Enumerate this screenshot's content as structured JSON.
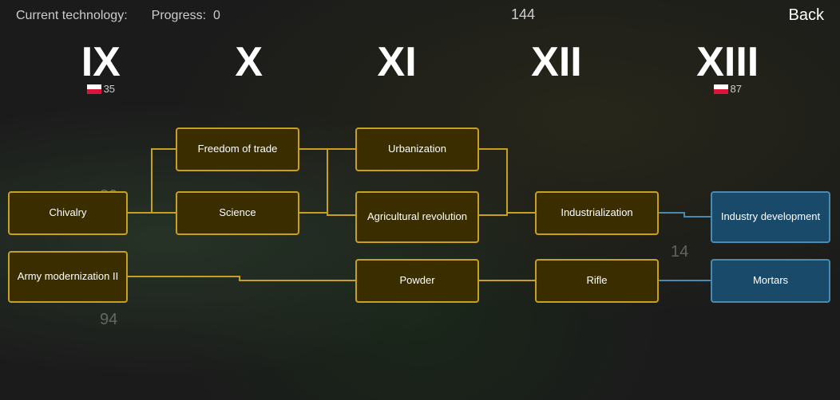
{
  "header": {
    "current_tech_label": "Current technology:",
    "progress_label": "Progress:",
    "progress_value": "0",
    "back_label": "Back"
  },
  "numerals": [
    {
      "id": "IX",
      "label": "IX",
      "badge_num": "35",
      "show_flag": true
    },
    {
      "id": "X",
      "label": "X",
      "badge_num": null,
      "show_flag": false
    },
    {
      "id": "XI",
      "label": "XI",
      "badge_num": null,
      "show_flag": false
    },
    {
      "id": "XII",
      "label": "XII",
      "badge_num": null,
      "show_flag": false
    },
    {
      "id": "XIII",
      "label": "XIII",
      "badge_num": "87",
      "show_flag": true
    }
  ],
  "top_badges": {
    "left_num": "144",
    "right_num": "87"
  },
  "nodes": {
    "chivalry": "Chivalry",
    "freedom_of_trade": "Freedom of trade",
    "science": "Science",
    "army_modernization": "Army modernization II",
    "urbanization": "Urbanization",
    "agricultural_revolution": "Agricultural revolution",
    "powder": "Powder",
    "industrialization": "Industrialization",
    "rifle": "Rifle",
    "industry_development": "Industry development",
    "mortars": "Mortars"
  },
  "map_numbers": {
    "n80": "80",
    "n35": "35",
    "n94": "94",
    "n14": "14",
    "n144": "144"
  },
  "colors": {
    "node_bg": "#3a2e00",
    "node_border": "#c8a020",
    "node_blue_bg": "#1a4a6a",
    "node_blue_border": "#4a8ab0",
    "connector_gold": "#c8a020",
    "connector_blue": "#4a8ab0"
  }
}
